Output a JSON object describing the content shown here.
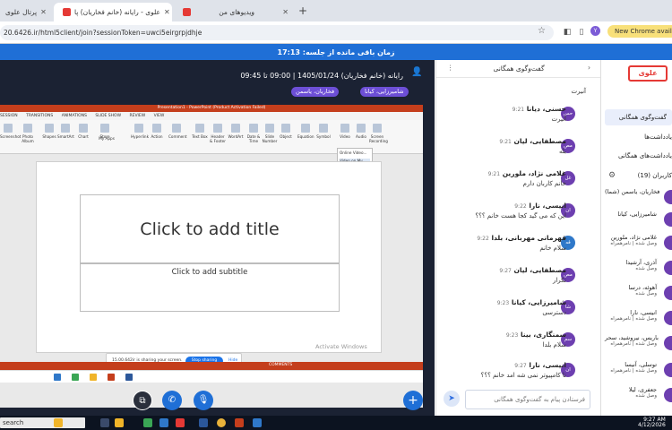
{
  "browser": {
    "tabs": [
      {
        "label": "پرتال علوی",
        "active": false
      },
      {
        "label": "علوی - رایانه (خانم فخاریان) پا",
        "active": true
      },
      {
        "label": "ویدیوهای من",
        "active": false
      }
    ],
    "url": "20.6426.ir/html5client/join?sessionToken=uwci5eirgrpjdhje",
    "new_chrome": "New Chrome availab",
    "profile_initial": "Y"
  },
  "banner": "زمان باقی مانده از جلسه: 17:13",
  "session": {
    "title": "رایانه (خانم فخاریان) 1405/01/24 | 09:00 تا 09:45",
    "presenters": [
      "شامیرزایی، کیانا",
      "فخاریان، یاسمن"
    ]
  },
  "shared_screen": {
    "app_title": "Presentation1 - PowerPoint (Product Activation Failed)",
    "ribbon_tabs": [
      "SESSION",
      "TRANSITIONS",
      "ANIMATIONS",
      "SLIDE SHOW",
      "REVIEW",
      "VIEW"
    ],
    "ribbon_buttons": [
      "Screenshot",
      "Photo Album",
      "Shapes",
      "SmartArt",
      "Chart",
      "Store",
      "My Apps",
      "Hyperlink",
      "Action",
      "Comment",
      "Text Box",
      "Header & Footer",
      "WordArt",
      "Date & Time",
      "Slide Number",
      "Object",
      "Equation",
      "Symbol",
      "Video",
      "Audio",
      "Screen Recording"
    ],
    "video_menu": [
      "Online Video...",
      "Video on My PC..."
    ],
    "slide_title": "Click to add title",
    "slide_subtitle": "Click to add subtitle",
    "watermark": "Activate Windows",
    "share_notice": "15.00.642ir is sharing your screen.",
    "stop_sharing": "Stop sharing",
    "hide": "Hide",
    "comments": "COMMENTS"
  },
  "chat": {
    "title": "گفت‌وگوی همگانی",
    "messages": [
      {
        "name": "",
        "time": "",
        "text": "آنیرت",
        "avatar": ""
      },
      {
        "name": "حسنی، دیانا",
        "time": "9:21",
        "text": "آنیرت",
        "avatar": "حس"
      },
      {
        "name": "مصطفایی، لیان",
        "time": "9:21",
        "text": "بله",
        "avatar": "مص"
      },
      {
        "name": "غلامی نژاد، ملورین",
        "time": "9:21",
        "text": "خانم کاربان دارم",
        "avatar": "غل"
      },
      {
        "name": "انیسی، نارا",
        "time": "9:22",
        "text": "این که می گید کجا هست خانم ؟؟؟",
        "avatar": "ان"
      },
      {
        "name": "قهرمانی مهربانی، بلدا",
        "time": "9:22",
        "text": "سلام خانم",
        "avatar": "قه"
      },
      {
        "name": "مصطفایی، لیان",
        "time": "9:27",
        "text": "تکرار",
        "avatar": "مص"
      },
      {
        "name": "شامیرزایی، کیانا",
        "time": "9:23",
        "text": "دسترسی",
        "avatar": "شا"
      },
      {
        "name": "سمنگاری، بینا",
        "time": "9:23",
        "text": "سلام بلدا",
        "avatar": "سم"
      },
      {
        "name": "انیسی، نارا",
        "time": "9:27",
        "text": "تا کامپیوتر نمی شه امد خانم ؟؟؟",
        "avatar": "ان"
      }
    ],
    "composer_placeholder": "فرستادن پیام به گفت‌وگوی همگانی"
  },
  "sidebar": {
    "logo": "علوی",
    "nav": [
      "گفت‌وگوی همگانی",
      "یادداشت‌ها",
      "یادداشت‌های همگانی"
    ],
    "users_header": "کاربران (19)",
    "users": [
      {
        "name": "فخاریان، یاسمن (شما)",
        "status": ""
      },
      {
        "name": "شامیرزایی، کیانا",
        "status": ""
      },
      {
        "name": "غلامی نژاد، ملورین",
        "status": "وصل شده | نامرهمراه"
      },
      {
        "name": "آذری، آرشیدا",
        "status": "وصل شده"
      },
      {
        "name": "آهوئه، درسا",
        "status": "وصل شده"
      },
      {
        "name": "انیسی، نارا",
        "status": "وصل شده | نامرهمراه"
      },
      {
        "name": "باریس، نیروشید، سحر",
        "status": "وصل شده | نامرهمراه"
      },
      {
        "name": "توسلی، آنیسا",
        "status": "وصل شده | نامرهمراه"
      },
      {
        "name": "جعفری، لیلا",
        "status": "وصل شده"
      }
    ]
  },
  "taskbar": {
    "search": "search",
    "time": "9:27 AM",
    "date": "4/12/2026"
  },
  "colors": {
    "banner": "#1f6fd6",
    "stage": "#1b2233",
    "accent": "#6d4fd6",
    "logo": "#e53935",
    "powerpoint": "#c43e1c"
  }
}
